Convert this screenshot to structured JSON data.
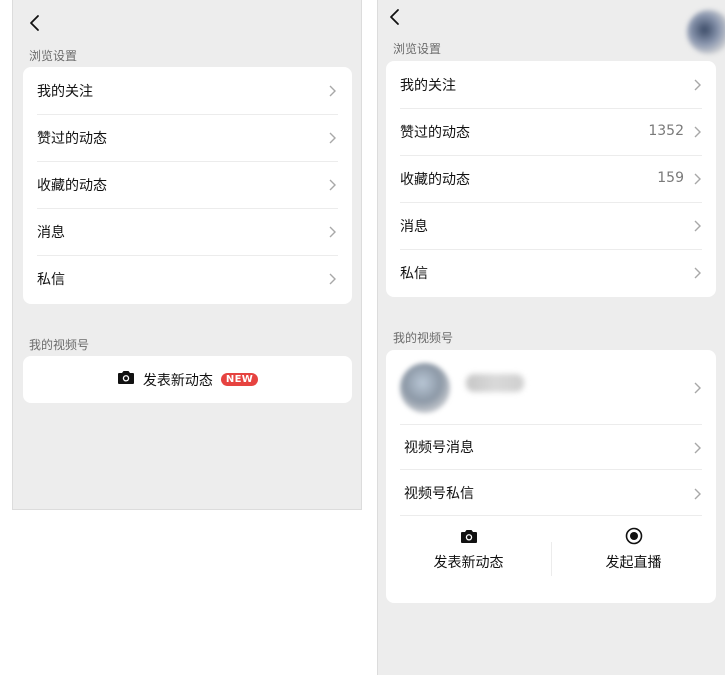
{
  "left": {
    "section_browse": "浏览设置",
    "items": [
      {
        "label": "我的关注"
      },
      {
        "label": "赞过的动态"
      },
      {
        "label": "收藏的动态"
      },
      {
        "label": "消息"
      },
      {
        "label": "私信"
      }
    ],
    "section_channel": "我的视频号",
    "post_label": "发表新动态",
    "new_badge": "NEW"
  },
  "right": {
    "section_browse": "浏览设置",
    "items": [
      {
        "label": "我的关注",
        "count": ""
      },
      {
        "label": "赞过的动态",
        "count": "1352"
      },
      {
        "label": "收藏的动态",
        "count": "159"
      },
      {
        "label": "消息",
        "count": ""
      },
      {
        "label": "私信",
        "count": ""
      }
    ],
    "section_channel": "我的视频号",
    "channel_items": [
      {
        "label": "视频号消息"
      },
      {
        "label": "视频号私信"
      }
    ],
    "post_label": "发表新动态",
    "live_label": "发起直播"
  },
  "colors": {
    "background": "#ededed",
    "card": "#ffffff",
    "badge": "#e64340",
    "muted_text": "#7a7a7a"
  },
  "icons": {
    "back": "chevron-left-icon",
    "row": "chevron-right-icon",
    "post": "camera-icon",
    "live": "live-record-icon"
  }
}
